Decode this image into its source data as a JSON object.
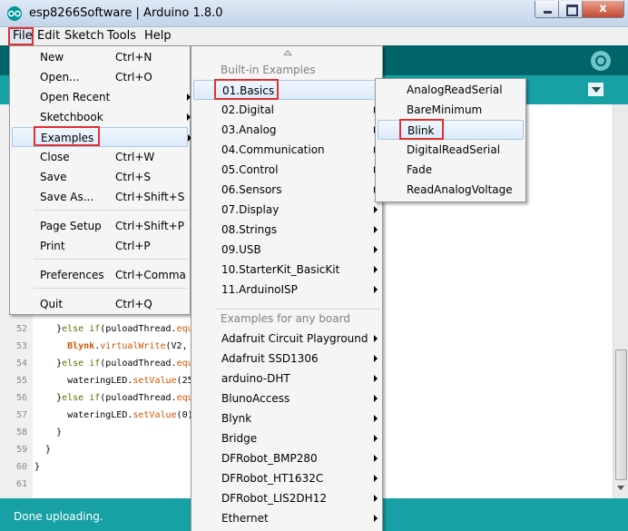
{
  "window": {
    "title": "esp8266Software | Arduino 1.8.0",
    "close_glyph": "x"
  },
  "menubar": {
    "items": [
      "File",
      "Edit",
      "Sketch",
      "Tools",
      "Help"
    ]
  },
  "code": {
    "lines": [
      {
        "num": "52",
        "parts": [
          {
            "t": "    }",
            "c": ""
          },
          {
            "t": "else",
            "c": "kw"
          },
          {
            "t": " ",
            "c": ""
          },
          {
            "t": "if",
            "c": "kw"
          },
          {
            "t": "(puloadThread.",
            "c": ""
          },
          {
            "t": "equ",
            "c": "fn"
          }
        ]
      },
      {
        "num": "53",
        "parts": [
          {
            "t": "      ",
            "c": ""
          },
          {
            "t": "Blynk",
            "c": "cls"
          },
          {
            "t": ".",
            "c": ""
          },
          {
            "t": "virtualWrite",
            "c": "fn"
          },
          {
            "t": "(V2,",
            "c": ""
          }
        ]
      },
      {
        "num": "54",
        "parts": [
          {
            "t": "    }",
            "c": ""
          },
          {
            "t": "else",
            "c": "kw"
          },
          {
            "t": " ",
            "c": ""
          },
          {
            "t": "if",
            "c": "kw"
          },
          {
            "t": "(puloadThread.",
            "c": ""
          },
          {
            "t": "equ",
            "c": "fn"
          }
        ]
      },
      {
        "num": "55",
        "parts": [
          {
            "t": "      wateringLED.",
            "c": ""
          },
          {
            "t": "setValue",
            "c": "fn"
          },
          {
            "t": "(25",
            "c": ""
          }
        ]
      },
      {
        "num": "56",
        "parts": [
          {
            "t": "    }",
            "c": ""
          },
          {
            "t": "else",
            "c": "kw"
          },
          {
            "t": " ",
            "c": ""
          },
          {
            "t": "if",
            "c": "kw"
          },
          {
            "t": "(puloadThread.",
            "c": ""
          },
          {
            "t": "equ",
            "c": "fn"
          }
        ]
      },
      {
        "num": "57",
        "parts": [
          {
            "t": "      wateringLED.",
            "c": ""
          },
          {
            "t": "setValue",
            "c": "fn"
          },
          {
            "t": "(0)",
            "c": ""
          }
        ]
      },
      {
        "num": "58",
        "parts": [
          {
            "t": "    }",
            "c": ""
          }
        ]
      },
      {
        "num": "59",
        "parts": [
          {
            "t": "  }",
            "c": ""
          }
        ]
      },
      {
        "num": "60",
        "parts": [
          {
            "t": "}",
            "c": ""
          }
        ]
      },
      {
        "num": "61",
        "parts": []
      }
    ]
  },
  "status": {
    "text": "Done uploading."
  },
  "file_menu": {
    "items": [
      {
        "label": "New",
        "shortcut": "Ctrl+N"
      },
      {
        "label": "Open...",
        "shortcut": "Ctrl+O"
      },
      {
        "label": "Open Recent",
        "shortcut": "",
        "submenu": true
      },
      {
        "label": "Sketchbook",
        "shortcut": "",
        "submenu": true
      },
      {
        "label": "Examples",
        "shortcut": "",
        "submenu": true,
        "highlighted": true
      },
      {
        "label": "Close",
        "shortcut": "Ctrl+W"
      },
      {
        "label": "Save",
        "shortcut": "Ctrl+S"
      },
      {
        "label": "Save As...",
        "shortcut": "Ctrl+Shift+S"
      },
      {
        "label": "Page Setup",
        "shortcut": "Ctrl+Shift+P"
      },
      {
        "label": "Print",
        "shortcut": "Ctrl+P"
      },
      {
        "label": "Preferences",
        "shortcut": "Ctrl+Comma"
      },
      {
        "label": "Quit",
        "shortcut": "Ctrl+Q"
      }
    ]
  },
  "examples_menu": {
    "builtin_header": "Built-in Examples",
    "builtin": [
      {
        "label": "01.Basics",
        "highlighted": true
      },
      {
        "label": "02.Digital"
      },
      {
        "label": "03.Analog"
      },
      {
        "label": "04.Communication"
      },
      {
        "label": "05.Control"
      },
      {
        "label": "06.Sensors"
      },
      {
        "label": "07.Display"
      },
      {
        "label": "08.Strings"
      },
      {
        "label": "09.USB"
      },
      {
        "label": "10.StarterKit_BasicKit"
      },
      {
        "label": "11.ArduinoISP"
      }
    ],
    "board_header": "Examples for any board",
    "board": [
      {
        "label": "Adafruit Circuit Playground"
      },
      {
        "label": "Adafruit SSD1306"
      },
      {
        "label": "arduino-DHT"
      },
      {
        "label": "BlunoAccess"
      },
      {
        "label": "Blynk"
      },
      {
        "label": "Bridge"
      },
      {
        "label": "DFRobot_BMP280"
      },
      {
        "label": "DFRobot_HT1632C"
      },
      {
        "label": "DFRobot_LIS2DH12"
      },
      {
        "label": "Ethernet"
      }
    ]
  },
  "basics_menu": {
    "items": [
      {
        "label": "AnalogReadSerial"
      },
      {
        "label": "BareMinimum"
      },
      {
        "label": "Blink",
        "highlighted": true
      },
      {
        "label": "DigitalReadSerial"
      },
      {
        "label": "Fade"
      },
      {
        "label": "ReadAnalogVoltage"
      }
    ]
  },
  "colors": {
    "toolbar": "#006468",
    "tabs_bar": "#17a1a5",
    "annotation_box": "#e03030"
  },
  "icons": {
    "app": "arduino-icon",
    "serial_monitor": "serial-monitor-icon",
    "tab_menu": "chevron-down-icon"
  }
}
